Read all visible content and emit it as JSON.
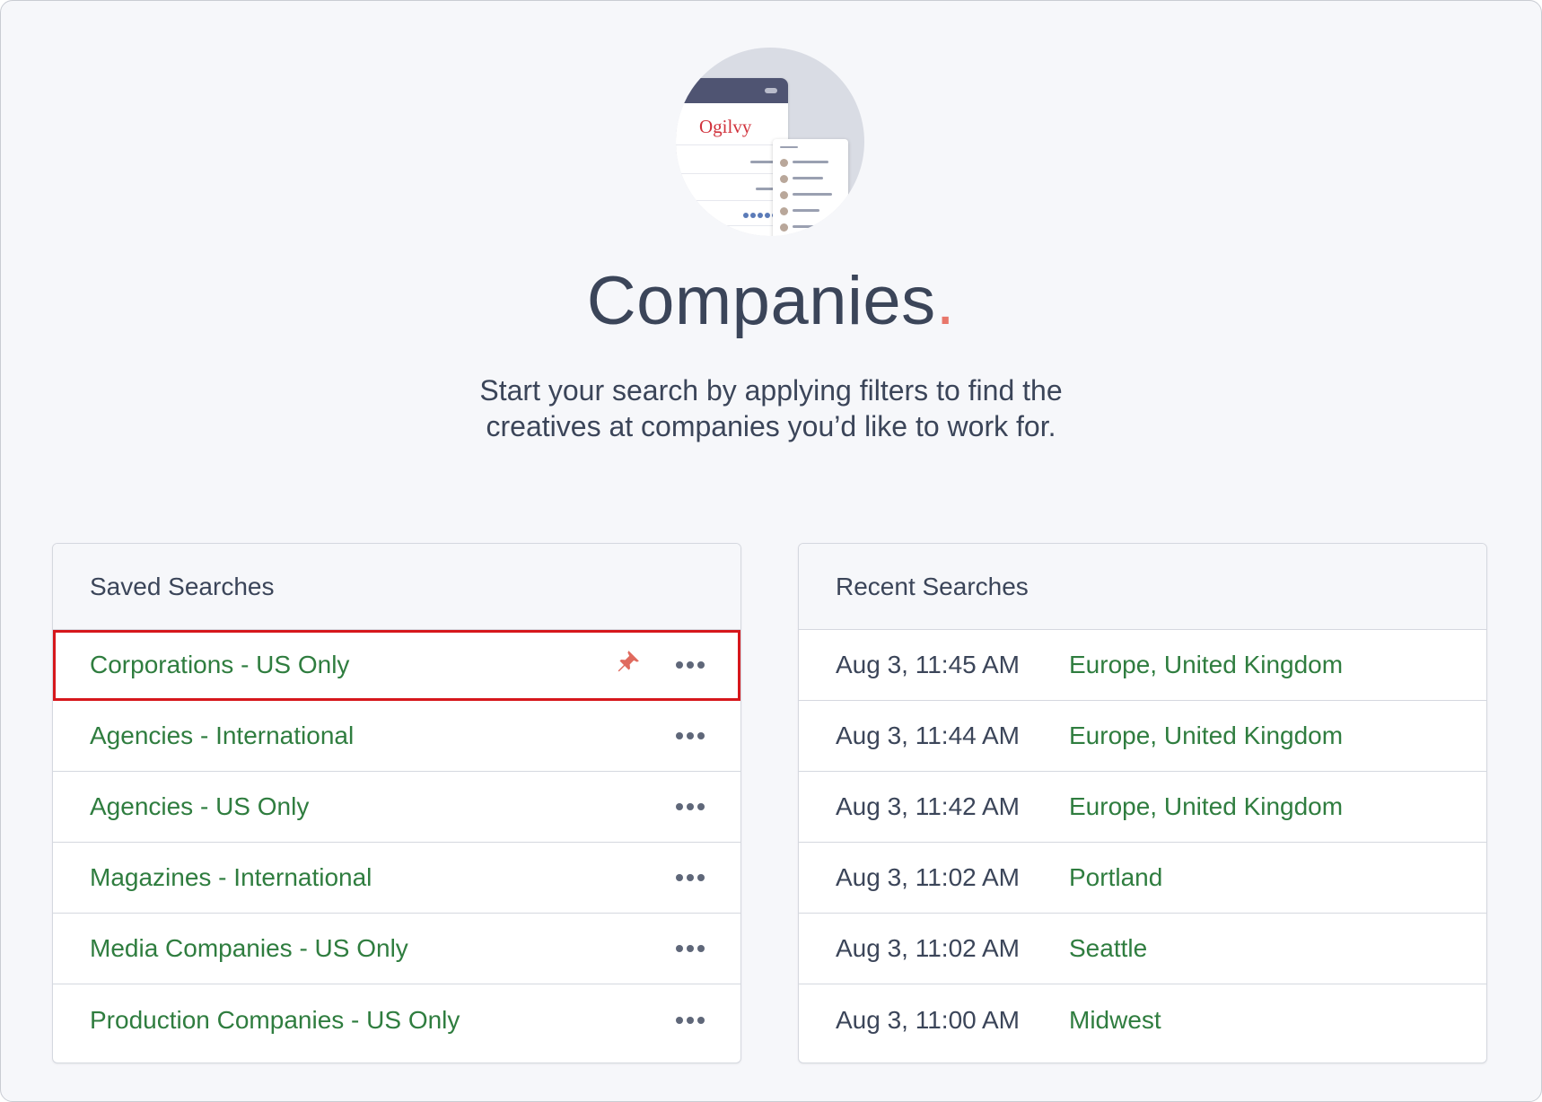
{
  "hero": {
    "logo_text": "Ogilvy",
    "icon": "company-profile-illustration"
  },
  "page": {
    "title": "Companies",
    "title_dot": ".",
    "subtitle_line1": "Start your search by applying filters to find the",
    "subtitle_line2": "creatives at companies you’d like to work for."
  },
  "saved": {
    "header": "Saved Searches",
    "items": [
      {
        "label": "Corporations - US Only",
        "pinned": true
      },
      {
        "label": "Agencies - International",
        "pinned": false
      },
      {
        "label": "Agencies - US Only",
        "pinned": false
      },
      {
        "label": "Magazines - International",
        "pinned": false
      },
      {
        "label": "Media Companies - US Only",
        "pinned": false
      },
      {
        "label": "Production Companies - US Only",
        "pinned": false
      }
    ]
  },
  "recent": {
    "header": "Recent Searches",
    "items": [
      {
        "time": "Aug 3, 11:45 AM",
        "query": "Europe, United Kingdom"
      },
      {
        "time": "Aug 3, 11:44 AM",
        "query": "Europe, United Kingdom"
      },
      {
        "time": "Aug 3, 11:42 AM",
        "query": "Europe, United Kingdom"
      },
      {
        "time": "Aug 3, 11:02 AM",
        "query": "Portland"
      },
      {
        "time": "Aug 3, 11:02 AM",
        "query": "Seattle"
      },
      {
        "time": "Aug 3, 11:00 AM",
        "query": "Midwest"
      }
    ]
  },
  "colors": {
    "link": "#2f7d3f",
    "text": "#3b4559",
    "accent_dot": "#e8766a",
    "pin": "#e06a5e",
    "highlight": "#d6171c"
  }
}
